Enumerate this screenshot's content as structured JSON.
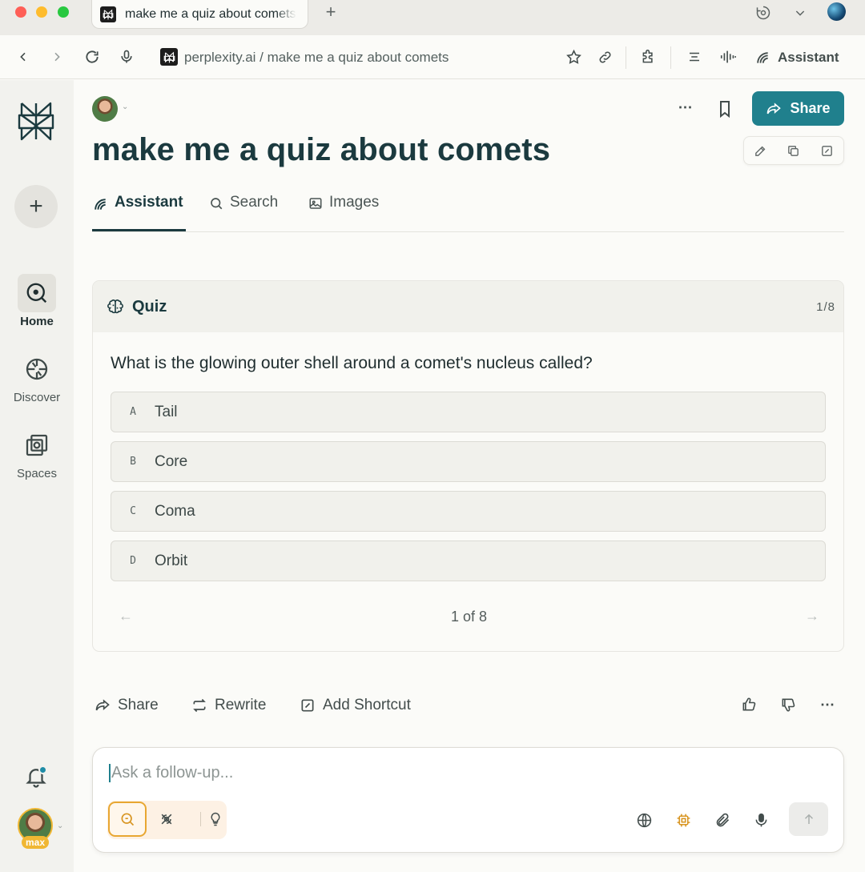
{
  "browser": {
    "tab_title": "make me a quiz about comets",
    "address": "perplexity.ai / make me a quiz about comets",
    "assistant_label": "Assistant"
  },
  "sidebar": {
    "items": [
      {
        "label": "Home",
        "icon": "home-icon",
        "active": true
      },
      {
        "label": "Discover",
        "icon": "discover-icon",
        "active": false
      },
      {
        "label": "Spaces",
        "icon": "spaces-icon",
        "active": false
      }
    ],
    "plan_badge": "max"
  },
  "header": {
    "share_label": "Share",
    "title": "make me a quiz about comets"
  },
  "tabs": [
    {
      "label": "Assistant",
      "active": true
    },
    {
      "label": "Search",
      "active": false
    },
    {
      "label": "Images",
      "active": false
    }
  ],
  "quiz": {
    "label": "Quiz",
    "counter": "1/8",
    "question": "What is the glowing outer shell around a comet's nucleus called?",
    "options": [
      {
        "letter": "A",
        "text": "Tail"
      },
      {
        "letter": "B",
        "text": "Core"
      },
      {
        "letter": "C",
        "text": "Coma"
      },
      {
        "letter": "D",
        "text": "Orbit"
      }
    ],
    "pagination": "1 of 8"
  },
  "actions": {
    "share": "Share",
    "rewrite": "Rewrite",
    "add_shortcut": "Add Shortcut"
  },
  "composer": {
    "placeholder": "Ask a follow-up...",
    "value": ""
  },
  "colors": {
    "accent": "#20808d",
    "title": "#1b3a3f",
    "pro_gold": "#e8a732"
  }
}
